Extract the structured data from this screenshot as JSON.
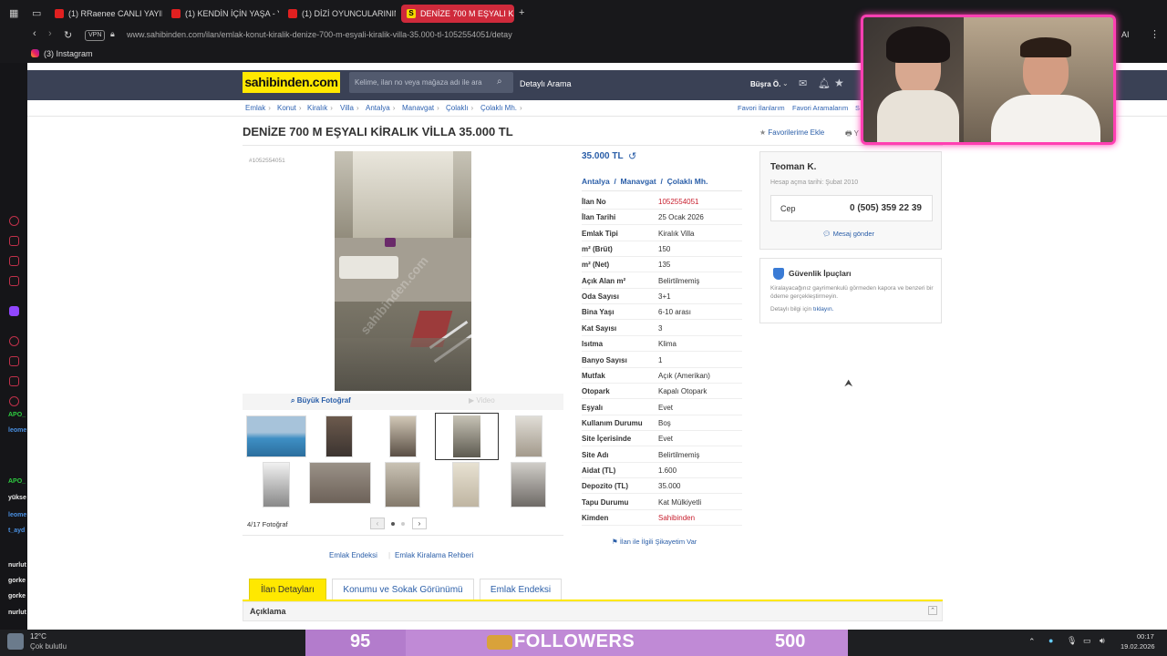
{
  "browser": {
    "tabs": [
      {
        "label": "(1) RRaenee CANLI YAYIN"
      },
      {
        "label": "(1) KENDİN İÇİN YAŞA - Y"
      },
      {
        "label": "(1) DİZİ OYUNCULARININ"
      },
      {
        "label": "DENİZE 700 M EŞYALI KİR"
      }
    ],
    "active_tab_icon": "S",
    "url": "www.sahibinden.com/ilan/emlak-konut-kiralik-denize-700-m-esyali-kiralik-villa-35.000-tl-1052554051/detay",
    "vpn_label": "VPN",
    "bookmark": "(3) Instagram",
    "ai_label": "AI"
  },
  "site": {
    "logo": "sahibinden.com",
    "search_placeholder": "Kelime, ilan no veya mağaza adı ile ara",
    "detailed_search": "Detaylı Arama",
    "user_name": "Büşra Ö.",
    "breadcrumb": [
      "Emlak",
      "Konut",
      "Kiralık",
      "Villa",
      "Antalya",
      "Manavgat",
      "Çolaklı",
      "Çolaklı Mh."
    ],
    "favorite_listings": "Favori İlanlarım",
    "favorite_searches": "Favori Aramalarım",
    "fav_trailing": "S",
    "add_favorite": "Favorilerime Ekle",
    "print_label": "Y"
  },
  "listing": {
    "title": "DENİZE 700 M EŞYALI KİRALIK VİLLA 35.000 TL",
    "id_tag": "#1052554051",
    "price": "35.000 TL",
    "location": [
      "Antalya",
      "Manavgat",
      "Çolaklı Mh."
    ],
    "big_photo": "Büyük Fotoğraf",
    "video": "Video",
    "photo_count": "4/17 Fotoğraf",
    "photo_watermark": "sahibinden.com",
    "attributes": [
      {
        "k": "İlan No",
        "v": "1052554051",
        "red": true
      },
      {
        "k": "İlan Tarihi",
        "v": "25 Ocak 2026"
      },
      {
        "k": "Emlak Tipi",
        "v": "Kiralık Villa"
      },
      {
        "k": "m² (Brüt)",
        "v": "150"
      },
      {
        "k": "m² (Net)",
        "v": "135"
      },
      {
        "k": "Açık Alan m²",
        "v": "Belirtilmemiş"
      },
      {
        "k": "Oda Sayısı",
        "v": "3+1"
      },
      {
        "k": "Bina Yaşı",
        "v": "6-10 arası"
      },
      {
        "k": "Kat Sayısı",
        "v": "3"
      },
      {
        "k": "Isıtma",
        "v": "Klima"
      },
      {
        "k": "Banyo Sayısı",
        "v": "1"
      },
      {
        "k": "Mutfak",
        "v": "Açık (Amerikan)"
      },
      {
        "k": "Otopark",
        "v": "Kapalı Otopark"
      },
      {
        "k": "Eşyalı",
        "v": "Evet"
      },
      {
        "k": "Kullanım Durumu",
        "v": "Boş"
      },
      {
        "k": "Site İçerisinde",
        "v": "Evet"
      },
      {
        "k": "Site Adı",
        "v": "Belirtilmemiş"
      },
      {
        "k": "Aidat (TL)",
        "v": "1.600"
      },
      {
        "k": "Depozito (TL)",
        "v": "35.000"
      },
      {
        "k": "Tapu Durumu",
        "v": "Kat Mülkiyetli"
      },
      {
        "k": "Kimden",
        "v": "Sahibinden",
        "red": true
      }
    ],
    "complaint": "İlan ile İlgili Şikayetim Var",
    "emlak_endeksi": "Emlak Endeksi",
    "kiralama_rehberi": "Emlak Kiralama Rehberi",
    "tabs": [
      "İlan Detayları",
      "Konumu ve Sokak Görünümü",
      "Emlak Endeksi"
    ],
    "description_header": "Açıklama"
  },
  "seller": {
    "name": "Teoman K.",
    "since": "Hesap açma tarihi: Şubat 2010",
    "phone_label": "Cep",
    "phone": "0 (505) 359 22 39",
    "message": "Mesaj gönder"
  },
  "security": {
    "title": "Güvenlik İpuçları",
    "text": "Kiralayacağınız gayrimenkulü görmeden kapora ve benzeri bir ödeme gerçekleştirmeyin.",
    "more_prefix": "Detaylı bilgi için",
    "more_link": "tıklayın."
  },
  "sidebar_chat": [
    "APO_",
    "leome",
    "APO_",
    "yükse",
    "leome",
    "t_ayd",
    "nurlut",
    "gorke",
    "gorke",
    "nurlut"
  ],
  "overlay": {
    "left_number": "95",
    "followers": "FOLLOWERS",
    "right_number": "500"
  },
  "taskbar": {
    "temperature": "12°C",
    "weather": "Çok bulutlu",
    "time": "00:17",
    "date": "19.02.2026"
  },
  "colors": {
    "header": "#3a4155",
    "logo_bg": "#ffe800",
    "link_blue": "#2a5ea8",
    "red_value": "#c8202f",
    "webcam_border": "#ff3fb2",
    "followers_bg": "#c08ad6"
  }
}
